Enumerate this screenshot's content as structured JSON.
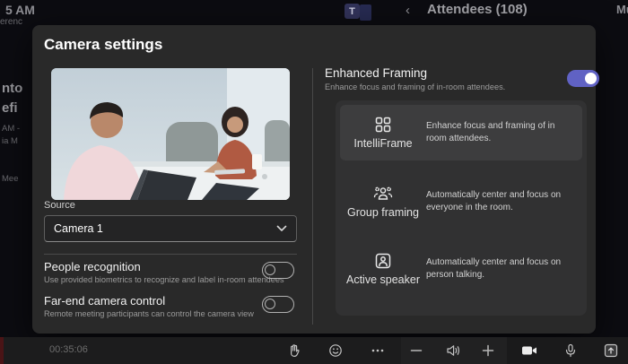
{
  "top_bar": {
    "time_partial": "5 AM",
    "conference_partial": "erenc",
    "teams_icon_letter": "T",
    "back_chevron": "‹",
    "attendees_label": "Attendees (108)",
    "mute_partial": "Mut"
  },
  "backdrop_fragments": {
    "f0": "nto",
    "f1": "efi",
    "f2": "AM -",
    "f3": "ia M",
    "f4": "Mee"
  },
  "dialog": {
    "title": "Camera settings",
    "preview_alt": "camera-preview-two-people-in-conference-room",
    "source": {
      "label": "Source",
      "value": "Camera 1"
    },
    "toggles": {
      "0": {
        "label": "People recognition",
        "description": "Use provided biometrics to recognize and label in-room attendees",
        "state": "off"
      },
      "1": {
        "label": "Far-end camera control",
        "description": "Remote meeting participants can control the camera view",
        "state": "off"
      }
    },
    "enhanced_framing": {
      "label": "Enhanced Framing",
      "description": "Enhance focus and framing of in-room attendees.",
      "state": "on",
      "options": {
        "0": {
          "label": "IntelliFrame",
          "description": "Enhance focus and framing of in room attendees.",
          "icon": "intelliframe-grid-icon",
          "selected": true
        },
        "1": {
          "label": "Group framing",
          "description": "Automatically center and focus on everyone in the room.",
          "icon": "people-group-icon",
          "selected": false
        },
        "2": {
          "label": "Active speaker",
          "description": "Automatically center and focus on person talking.",
          "icon": "person-frame-icon",
          "selected": false
        }
      }
    }
  },
  "bottom_bar": {
    "timestamp": "00:35:06",
    "icons": [
      "raise-hand-icon",
      "emoji-icon",
      "more-icon",
      "minus-icon",
      "speaker-icon",
      "plus-icon",
      "camera-icon",
      "mic-icon",
      "share-screen-icon"
    ]
  },
  "colors": {
    "accent_toggle_on": "#6062C4",
    "dialog_bg": "#292929",
    "options_panel_bg": "#313132",
    "selected_option_bg": "#3D3D3E",
    "page_bg": "#0C0C11",
    "bottom_bar_bg": "#1C1C1D"
  }
}
